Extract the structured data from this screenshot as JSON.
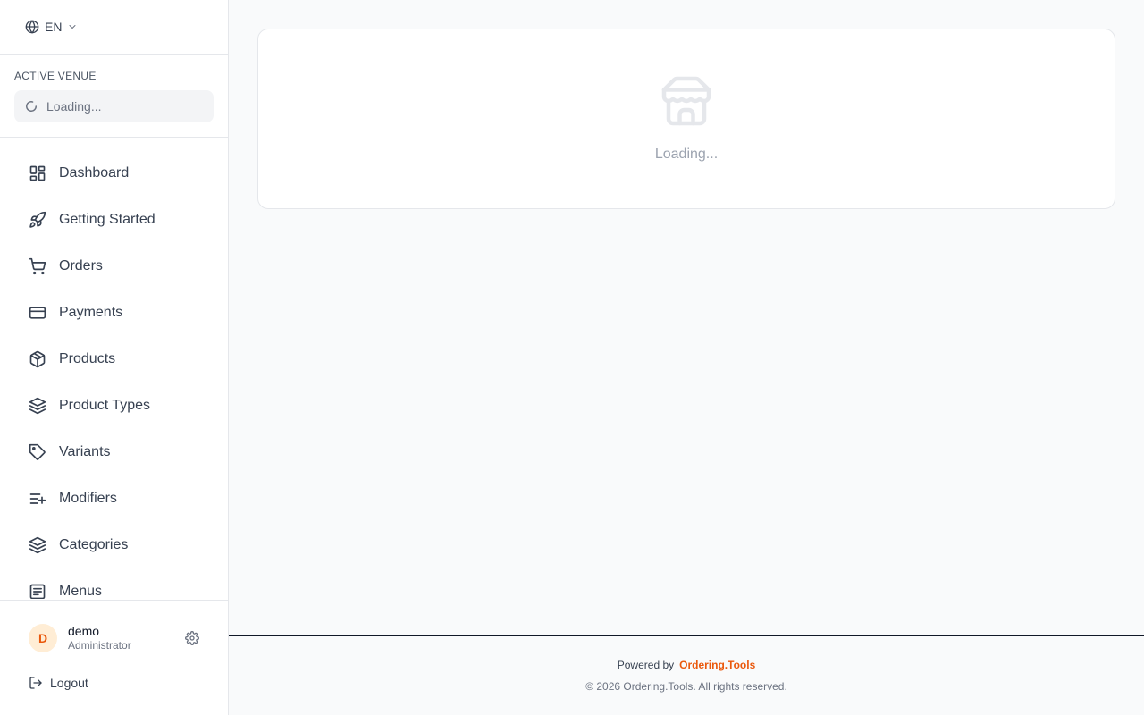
{
  "language": {
    "code": "EN"
  },
  "venue": {
    "label": "ACTIVE VENUE",
    "loading_text": "Loading..."
  },
  "nav": {
    "items": [
      {
        "label": "Dashboard",
        "icon": "dashboard-icon"
      },
      {
        "label": "Getting Started",
        "icon": "rocket-icon"
      },
      {
        "label": "Orders",
        "icon": "cart-icon"
      },
      {
        "label": "Payments",
        "icon": "credit-card-icon"
      },
      {
        "label": "Products",
        "icon": "package-icon"
      },
      {
        "label": "Product Types",
        "icon": "layers-icon"
      },
      {
        "label": "Variants",
        "icon": "tag-icon"
      },
      {
        "label": "Modifiers",
        "icon": "list-plus-icon"
      },
      {
        "label": "Categories",
        "icon": "layers-icon"
      },
      {
        "label": "Menus",
        "icon": "menu-doc-icon"
      }
    ]
  },
  "user": {
    "initial": "D",
    "name": "demo",
    "role": "Administrator",
    "logout_label": "Logout"
  },
  "main": {
    "loading_text": "Loading..."
  },
  "footer": {
    "powered_by": "Powered by",
    "brand": "Ordering.Tools",
    "copyright": "© 2026 Ordering.Tools. All rights reserved."
  },
  "colors": {
    "accent": "#ea580c",
    "avatar_bg": "#ffedd5"
  }
}
